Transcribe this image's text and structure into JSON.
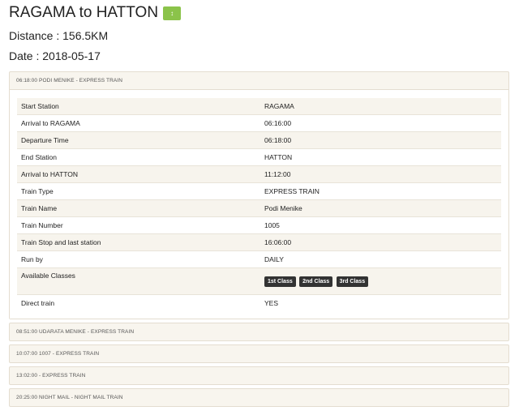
{
  "route": {
    "title": "RAGAMA to HATTON",
    "badge": "↕"
  },
  "distance": "Distance : 156.5KM",
  "date": "Date : 2018-05-17",
  "trains": [
    {
      "header": "06:18:00 PODI MENIKE - EXPRESS TRAIN",
      "details": [
        {
          "label": "Start Station",
          "value": "RAGAMA"
        },
        {
          "label": "Arrival to RAGAMA",
          "value": "06:16:00"
        },
        {
          "label": "Departure Time",
          "value": "06:18:00"
        },
        {
          "label": "End Station",
          "value": "HATTON"
        },
        {
          "label": "Arrival to HATTON",
          "value": "11:12:00"
        },
        {
          "label": "Train Type",
          "value": "EXPRESS TRAIN"
        },
        {
          "label": "Train Name",
          "value": "Podi Menike"
        },
        {
          "label": "Train Number",
          "value": "1005"
        },
        {
          "label": "Train Stop and last station",
          "value": "16:06:00"
        },
        {
          "label": "Run by",
          "value": "DAILY"
        }
      ],
      "classes_label": "Available Classes",
      "classes": [
        "1st Class",
        "2nd Class",
        "3rd Class"
      ],
      "direct_label": "Direct train",
      "direct_value": "YES"
    },
    {
      "header": "08:51:00 UDARATA MENIKE - EXPRESS TRAIN"
    },
    {
      "header": "10:07:00 1007 - EXPRESS TRAIN"
    },
    {
      "header": "13:02:00 - EXPRESS TRAIN"
    },
    {
      "header": "20:25:00 NIGHT MAIL - NIGHT MAIL TRAIN"
    }
  ],
  "colors": {
    "badge": "#8bc34a",
    "panel_bg": "#f8f5ee",
    "chip_bg": "#333333"
  }
}
